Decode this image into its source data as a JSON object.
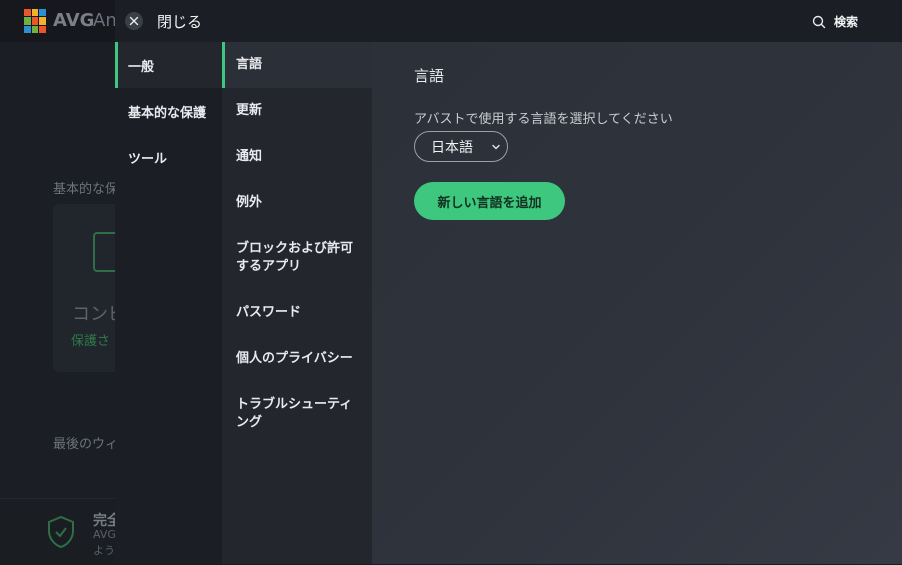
{
  "background_app": {
    "logo_text": "AVG",
    "logo_text_rest": "An",
    "section_label": "基本的な保",
    "card_title": "コンピ",
    "card_status": "保護さ",
    "last_scan_label": "最後のウィ",
    "bottom_title": "完全",
    "bottom_sub1": "AVG",
    "bottom_sub2": "よう",
    "logo_colors": [
      "#e8562a",
      "#f3b12d",
      "#2c8fd6",
      "#6fb23f"
    ],
    "accent_color": "#3ec77e"
  },
  "header": {
    "close_label": "閉じる",
    "search_label": "検索",
    "close_icon": "close-icon",
    "search_icon": "search-icon"
  },
  "nav_primary": {
    "items": [
      {
        "label": "一般",
        "active": true
      },
      {
        "label": "基本的な保護",
        "active": false
      },
      {
        "label": "ツール",
        "active": false
      }
    ]
  },
  "nav_secondary": {
    "items": [
      {
        "label": "言語",
        "active": true
      },
      {
        "label": "更新",
        "active": false
      },
      {
        "label": "通知",
        "active": false
      },
      {
        "label": "例外",
        "active": false
      },
      {
        "label": "ブロックおよび許可するアプリ",
        "active": false
      },
      {
        "label": "パスワード",
        "active": false
      },
      {
        "label": "個人のプライバシー",
        "active": false
      },
      {
        "label": "トラブルシューティング",
        "active": false
      }
    ]
  },
  "content": {
    "title": "言語",
    "description": "アバストで使用する言語を選択してください",
    "language_select": {
      "value": "日本語"
    },
    "add_button_label": "新しい言語を追加"
  },
  "colors": {
    "accent": "#3ec77e",
    "panel_dark": "#1b1e24",
    "panel_mid": "#23262d",
    "content_bg": "#2f333c"
  }
}
